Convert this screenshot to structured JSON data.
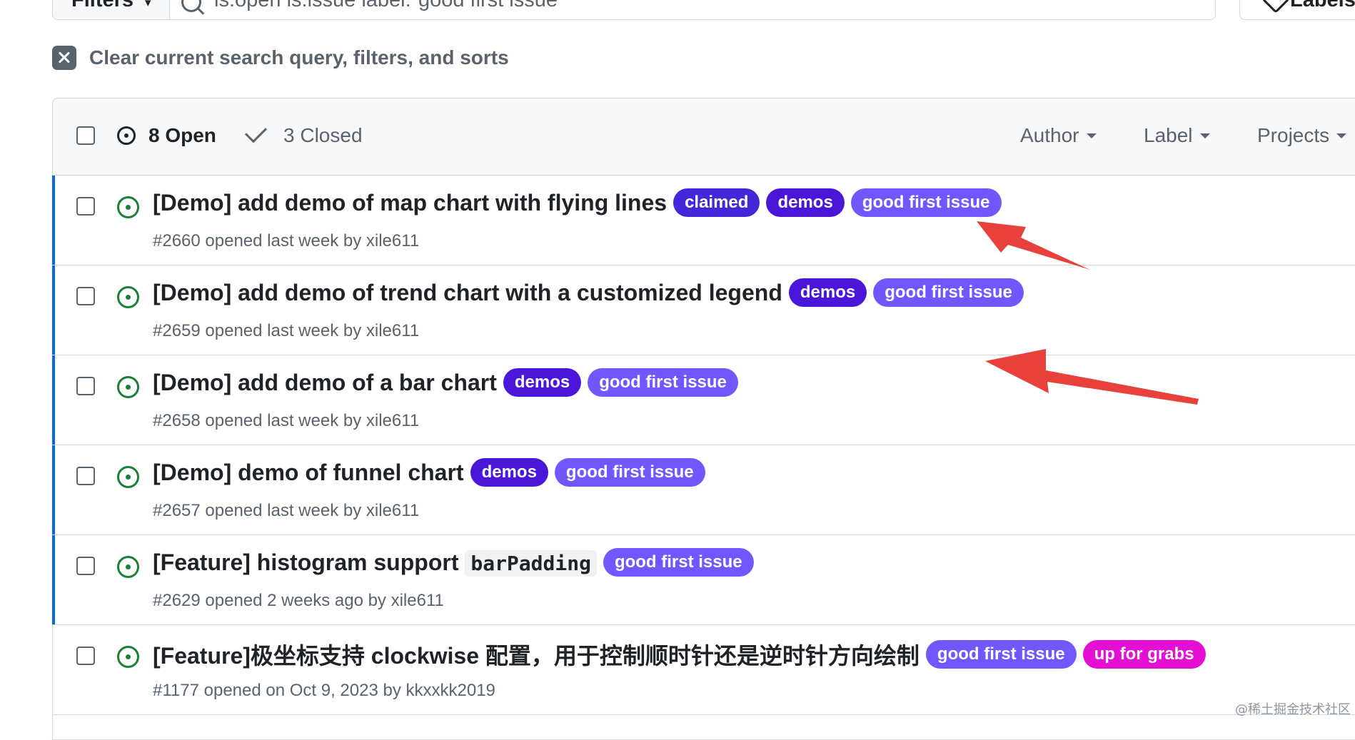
{
  "search": {
    "filters_label": "Filters",
    "query": "is:open is:issue label:\"good first issue\"",
    "labels_button": "Labels"
  },
  "clear_query": "Clear current search query, filters, and sorts",
  "header": {
    "open_count": "8 Open",
    "closed_count": "3 Closed",
    "menus": [
      "Author",
      "Label",
      "Projects"
    ]
  },
  "issues": [
    {
      "title": "[Demo] add demo of map chart with flying lines",
      "meta": "#2660 opened last week by xile611",
      "labels": [
        "claimed",
        "demos",
        "good first issue"
      ]
    },
    {
      "title": "[Demo] add demo of trend chart with a customized legend",
      "meta": "#2659 opened last week by xile611",
      "labels": [
        "demos",
        "good first issue"
      ]
    },
    {
      "title": "[Demo] add demo of a bar chart",
      "meta": "#2658 opened last week by xile611",
      "labels": [
        "demos",
        "good first issue"
      ]
    },
    {
      "title": "[Demo] demo of funnel chart",
      "meta": "#2657 opened last week by xile611",
      "labels": [
        "demos",
        "good first issue"
      ]
    },
    {
      "title_prefix": "[Feature] histogram support",
      "title_code": "barPadding",
      "meta": "#2629 opened 2 weeks ago by xile611",
      "labels": [
        "good first issue"
      ]
    },
    {
      "title": "[Feature]极坐标支持 clockwise 配置，用于控制顺时针还是逆时针方向绘制",
      "meta": "#1177 opened on Oct 9, 2023 by kkxxkk2019",
      "labels": [
        "good first issue",
        "up for grabs"
      ]
    }
  ],
  "label_colors": {
    "claimed": "#4526d8",
    "demos": "#4a17d9",
    "good first issue": "#7057ff",
    "up for grabs": "#e40fd3"
  },
  "annotation_color": "#e8413b",
  "watermark": "@稀土掘金技术社区"
}
